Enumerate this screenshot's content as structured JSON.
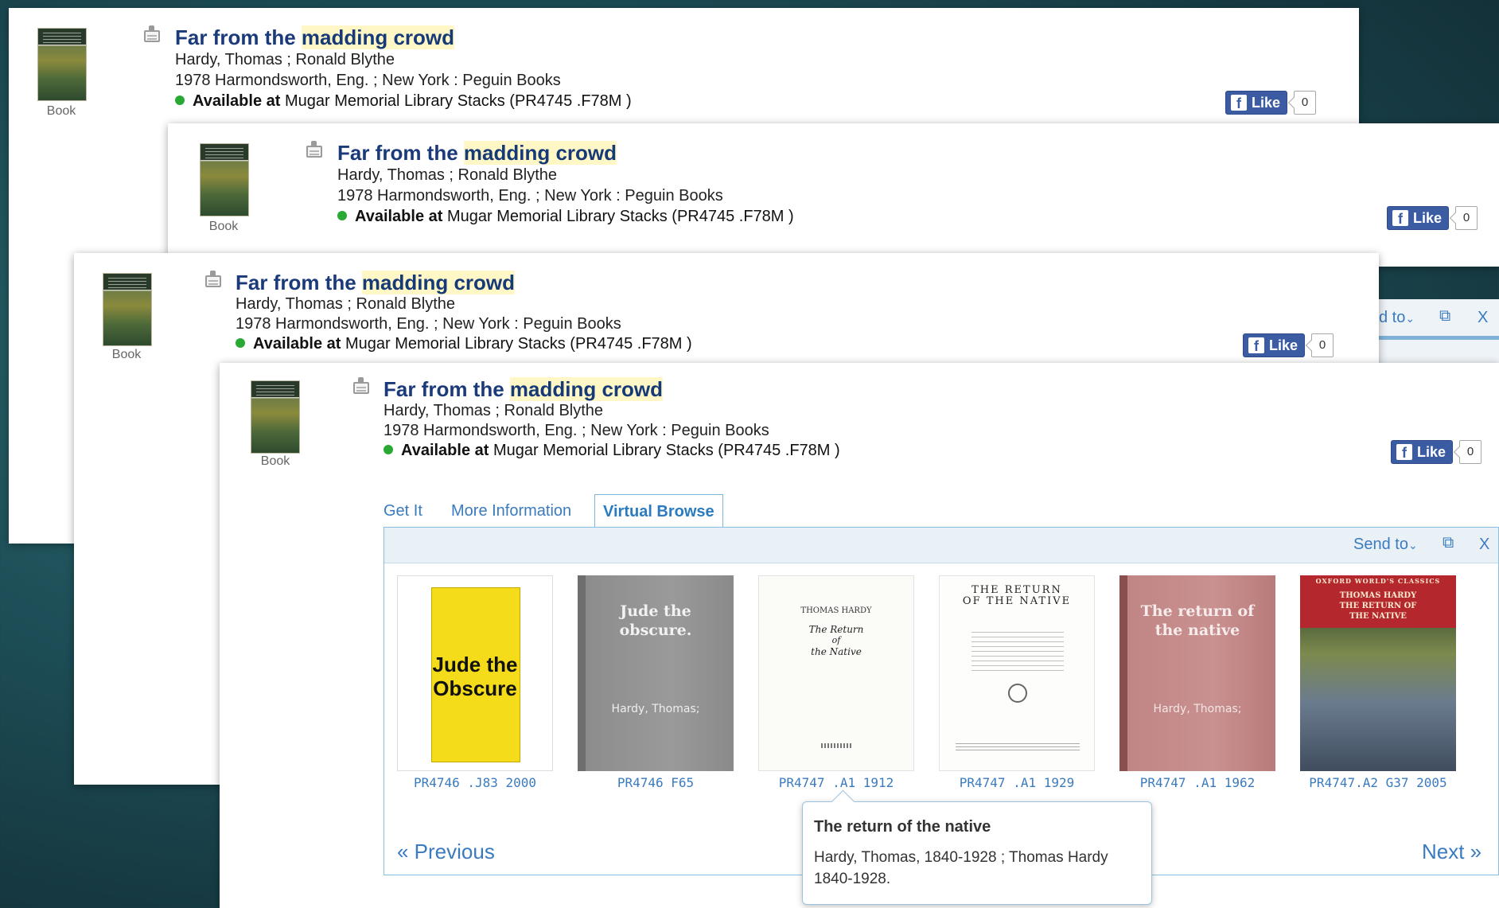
{
  "record": {
    "format": "Book",
    "title_prefix": "Far from the ",
    "title_highlight": "madding crowd",
    "author": "Hardy, Thomas ; Ronald Blythe",
    "publication": "1978 Harmondsworth, Eng. ; New York : Peguin Books",
    "avail_label": "Available at",
    "avail_location": " Mugar Memorial Library Stacks (PR4745 .F78M )",
    "like_label": "Like",
    "like_count": "0"
  },
  "tabs": [
    {
      "label": "Get It"
    },
    {
      "label": "More Information"
    },
    {
      "label": "Virtual Browse"
    }
  ],
  "toolbar": {
    "send_to": "Send to",
    "ghost_send": "d to",
    "close": "X"
  },
  "books": [
    {
      "callno": "PR4746 .J83 2000",
      "cover_line1": "Jude the",
      "cover_line2": "Obscure",
      "cover_color": "#f4dc1a"
    },
    {
      "callno": "PR4746 F65",
      "cover_line1": "Jude the",
      "cover_line2": "obscure.",
      "cover_author": "Hardy, Thomas;",
      "cover_color": "#888888"
    },
    {
      "callno": "PR4747 .A1 1912",
      "cover_header": "THOMAS HARDY",
      "cover_line1": "The Return",
      "cover_line2": "of",
      "cover_line3": "the Native"
    },
    {
      "callno": "PR4747 .A1 1929",
      "cover_line1": "THE RETURN",
      "cover_line2": "OF THE NATIVE"
    },
    {
      "callno": "PR4747 .A1 1962",
      "cover_line1": "The return of",
      "cover_line2": "the native",
      "cover_author": "Hardy, Thomas;",
      "cover_color": "#c08584"
    },
    {
      "callno": "PR4747.A2 G37 2005",
      "cover_header": "OXFORD WORLD'S CLASSICS",
      "cover_line1": "THOMAS HARDY",
      "cover_line2": "THE RETURN OF",
      "cover_line3": "THE NATIVE",
      "cover_color": "#b3272d"
    }
  ],
  "tooltip": {
    "title": "The return of the native",
    "body": "Hardy, Thomas, 1840-1928 ; Thomas Hardy 1840-1928."
  },
  "pager": {
    "previous": "« Previous",
    "next": "Next »"
  }
}
